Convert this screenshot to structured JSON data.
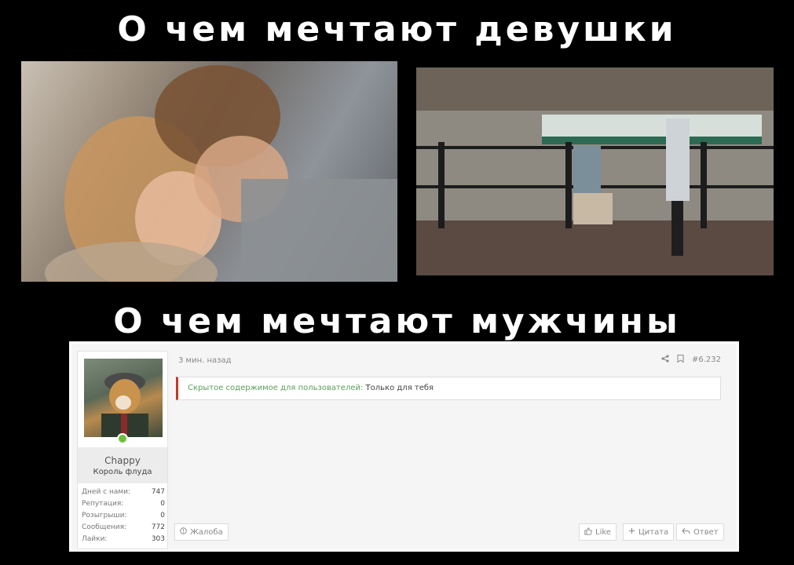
{
  "headings": {
    "top": "О чем мечтают девушки",
    "bottom": "О чем мечтают мужчины"
  },
  "post": {
    "time": "3 мин. назад",
    "post_number": "#6.232",
    "user": {
      "name": "Chappy",
      "title": "Король флуда",
      "stats": [
        {
          "label": "Дней с нами:",
          "value": "747"
        },
        {
          "label": "Репутация:",
          "value": "0"
        },
        {
          "label": "Розыгрыши:",
          "value": "0"
        },
        {
          "label": "Сообщения:",
          "value": "772"
        },
        {
          "label": "Лайки:",
          "value": "303"
        }
      ]
    },
    "hidden_content": {
      "label": "Скрытое содержимое для пользователей:",
      "value": "Только для тебя"
    },
    "buttons": {
      "report": "Жалоба",
      "like": "Like",
      "quote": "Цитата",
      "reply": "Ответ"
    }
  },
  "colors": {
    "accent_bar": "#c0392b",
    "online": "#6fbf3a",
    "hidden_label": "#5a9e5a"
  }
}
